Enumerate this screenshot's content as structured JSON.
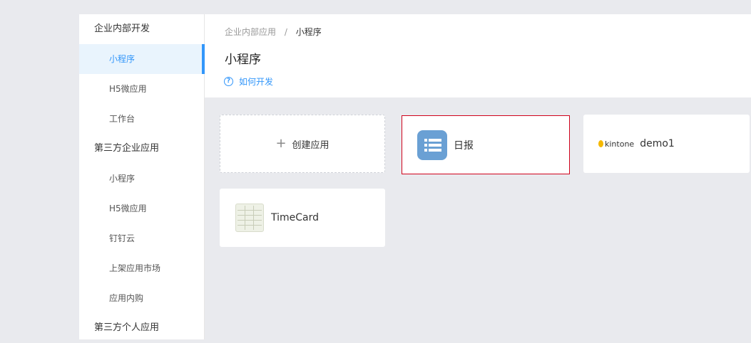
{
  "sidebar": {
    "sections": [
      {
        "title": "企业内部开发",
        "items": [
          "小程序",
          "H5微应用",
          "工作台"
        ]
      },
      {
        "title": "第三方企业应用",
        "items": [
          "小程序",
          "H5微应用",
          "钉钉云",
          "上架应用市场",
          "应用内购"
        ]
      },
      {
        "title": "第三方个人应用",
        "items": []
      }
    ],
    "active_item": "小程序"
  },
  "header": {
    "breadcrumb": [
      "企业内部应用",
      "小程序"
    ],
    "breadcrumb_separator": "/",
    "title": "小程序",
    "help_link": "如何开发",
    "help_icon": "?"
  },
  "apps": {
    "create_label": "创建应用",
    "create_icon": "+",
    "list": [
      {
        "name": "日报",
        "icon": "list-doc-icon"
      },
      {
        "name": "demo1",
        "icon": "kintone-logo",
        "logo_text": "kintone"
      },
      {
        "name": "TimeCard",
        "icon": "spreadsheet-icon"
      }
    ]
  },
  "colors": {
    "accent": "#3296fa",
    "selected_border": "#d0021b",
    "background": "#e9eaee"
  }
}
